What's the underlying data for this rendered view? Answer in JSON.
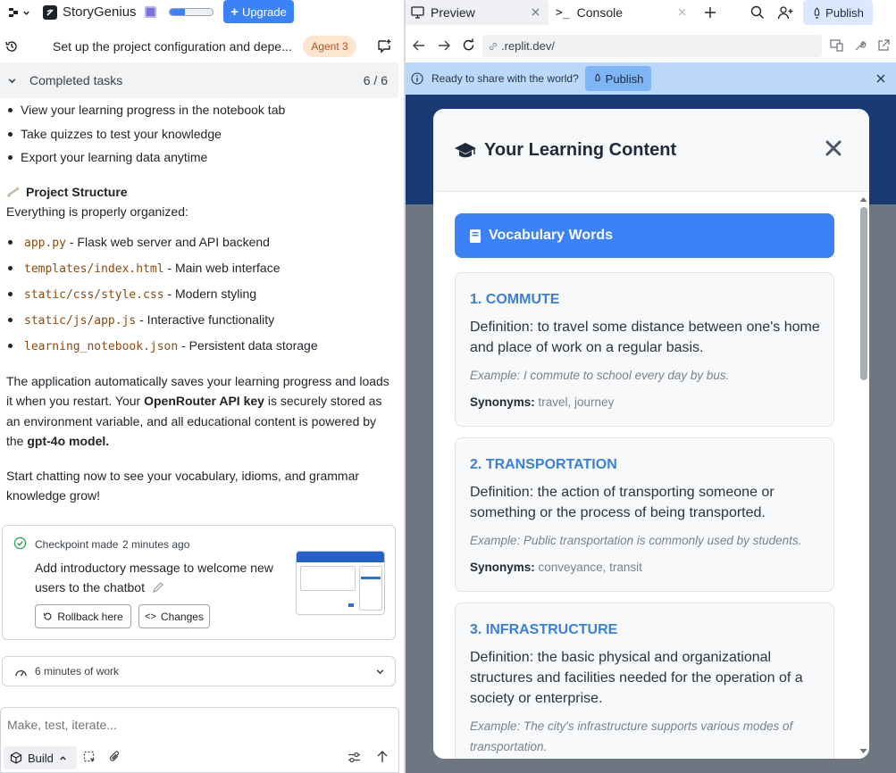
{
  "sidebar": {
    "project_name": "StoryGenius",
    "progress": 0.35,
    "upgrade_label": "Upgrade",
    "task_title": "Set up the project configuration and depe...",
    "agent_badge": "Agent 3",
    "completed_label": "Completed tasks",
    "completed_count": "6 / 6",
    "top_bullets": [
      "View your learning progress in the notebook tab",
      "Take quizzes to test your knowledge",
      "Export your learning data anytime"
    ],
    "structure_heading": "Project Structure",
    "structure_intro": "Everything is properly organized:",
    "files": [
      {
        "name": "app.py",
        "desc": " - Flask web server and API backend"
      },
      {
        "name": "templates/index.html",
        "desc": " - Main web interface"
      },
      {
        "name": "static/css/style.css",
        "desc": " - Modern styling"
      },
      {
        "name": "static/js/app.js",
        "desc": " - Interactive functionality"
      },
      {
        "name": "learning_notebook.json",
        "desc": " - Persistent data storage"
      }
    ],
    "para1_a": "The application automatically saves your learning progress and loads it when you restart. Your ",
    "para1_b": "OpenRouter API key",
    "para1_c": " is securely stored as an environment variable, and all educational content is powered by the ",
    "para1_d": "gpt-4o model.",
    "para2": "Start chatting now to see your vocabulary, idioms, and grammar knowledge grow!",
    "checkpoint": {
      "label": "Checkpoint made",
      "time": "2 minutes ago",
      "message": "Add introductory message to welcome new users to the chatbot",
      "rollback_label": "Rollback here",
      "changes_label": "Changes"
    },
    "worklog_label": "6 minutes of work",
    "input_placeholder": "Make, test, iterate...",
    "build_label": "Build"
  },
  "preview": {
    "tab_preview": "Preview",
    "tab_console": "Console",
    "publish_label": "Publish",
    "url": ".replit.dev/",
    "banner_text": "Ready to share with the world?",
    "banner_publish": "Publish",
    "modal_title": "Your Learning Content",
    "vocab_button": "Vocabulary Words",
    "cards": [
      {
        "title": "1. COMMUTE",
        "definition": "Definition: to travel some distance between one's home and place of work on a regular basis.",
        "example": "Example: I commute to school every day by bus.",
        "synonyms_label": "Synonyms:",
        "synonyms": " travel, journey"
      },
      {
        "title": "2. TRANSPORTATION",
        "definition": "Definition: the action of transporting someone or something or the process of being transported.",
        "example": "Example: Public transportation is commonly used by students.",
        "synonyms_label": "Synonyms:",
        "synonyms": " conveyance, transit"
      },
      {
        "title": "3. INFRASTRUCTURE",
        "definition": "Definition: the basic physical and organizational structures and facilities needed for the operation of a society or enterprise.",
        "example": "Example: The city's infrastructure supports various modes of transportation."
      }
    ]
  },
  "colors": {
    "accent": "#3b82f6",
    "banner": "#bcd9fb",
    "card_title": "#3b7fd9",
    "agent_badge_bg": "#fde5cf"
  }
}
